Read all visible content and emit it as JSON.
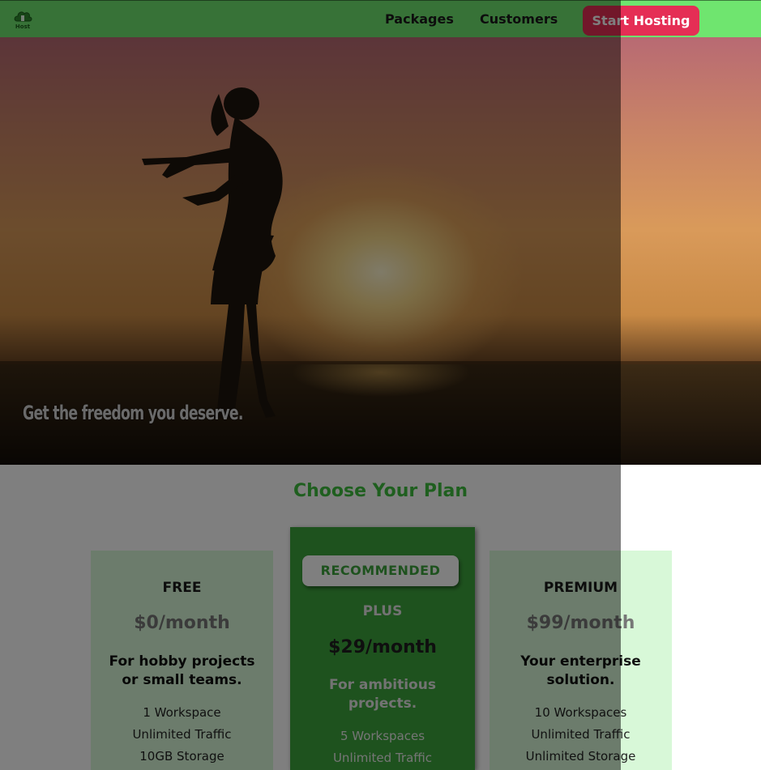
{
  "header": {
    "logo_text": "Host",
    "nav": [
      {
        "label": "Packages"
      },
      {
        "label": "Customers"
      }
    ],
    "cta_label": "Start Hosting"
  },
  "hero": {
    "tagline": "Get the freedom you deserve."
  },
  "plans": {
    "title": "Choose Your Plan",
    "items": [
      {
        "name": "FREE",
        "price": "$0/month",
        "desc_lines": [
          "For hobby projects",
          "or small teams."
        ],
        "features": [
          "1 Workspace",
          "Unlimited Traffic",
          "10GB Storage"
        ]
      },
      {
        "badge": "RECOMMENDED",
        "name": "PLUS",
        "price": "$29/month",
        "desc_lines": [
          "For ambitious",
          "projects."
        ],
        "features": [
          "5 Workspaces",
          "Unlimited Traffic"
        ]
      },
      {
        "name": "PREMIUM",
        "price": "$99/month",
        "desc_lines": [
          "Your enterprise",
          "solution."
        ],
        "features": [
          "10 Workspaces",
          "Unlimited Traffic",
          "Unlimited Storage"
        ]
      }
    ]
  },
  "colors": {
    "header_bg": "#6fe56f",
    "cta_bg": "#e52e55",
    "accent_green": "#3da43d",
    "card_bg": "#d8f8d8",
    "backdrop": "rgba(0,0,0,0.5)"
  },
  "icons": {
    "logo": "cloud-logo-icon"
  }
}
